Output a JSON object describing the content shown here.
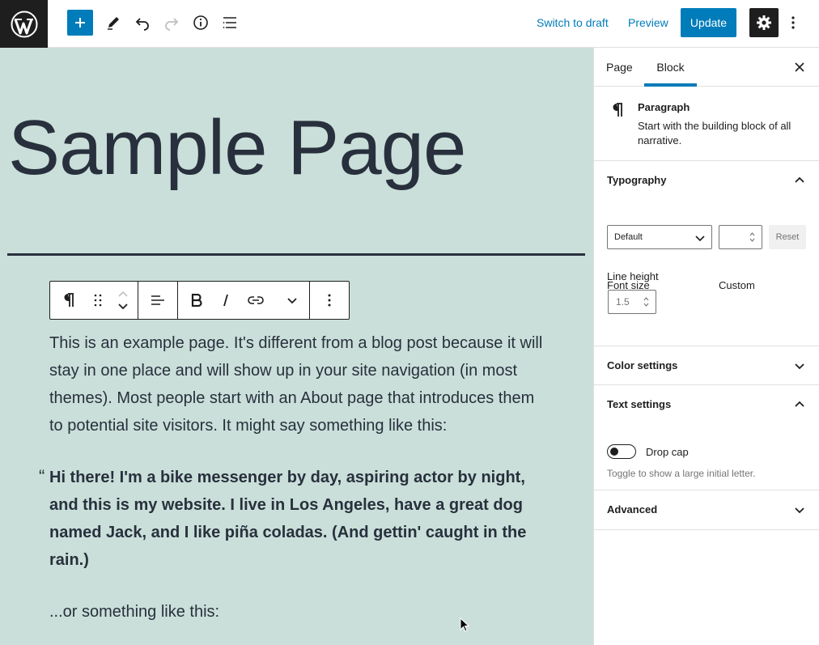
{
  "topbar": {
    "switch_to_draft": "Switch to draft",
    "preview": "Preview",
    "update": "Update"
  },
  "editor": {
    "title": "Sample Page",
    "paragraph1": "This is an example page. It's different from a blog post because it will stay in one place and will show up in your site navigation (in most themes). Most people start with an About page that introduces them to potential site visitors. It might say something like this:",
    "quote_mark": "“",
    "quote": "Hi there! I'm a bike messenger by day, aspiring actor by night, and this is my website. I live in Los Angeles, have a great dog named Jack, and I like piña coladas. (And gettin' caught in the rain.)",
    "paragraph2": "...or something like this:"
  },
  "sidebar": {
    "tabs": [
      {
        "label": "Page",
        "active": false
      },
      {
        "label": "Block",
        "active": true
      }
    ],
    "block": {
      "name": "Paragraph",
      "description": "Start with the building block of all narrative."
    },
    "typography": {
      "title": "Typography",
      "font_size_label": "Font size",
      "custom_label": "Custom",
      "font_size_value": "Default",
      "custom_value": "",
      "reset": "Reset",
      "line_height_label": "Line height",
      "line_height_value": "1.5"
    },
    "color_settings": {
      "title": "Color settings"
    },
    "text_settings": {
      "title": "Text settings",
      "drop_cap_label": "Drop cap",
      "drop_cap_help": "Toggle to show a large initial letter.",
      "drop_cap_enabled": false
    },
    "advanced": {
      "title": "Advanced"
    }
  },
  "colors": {
    "accent": "#007cba",
    "canvas": "#cadfd9",
    "text": "#28303d"
  }
}
